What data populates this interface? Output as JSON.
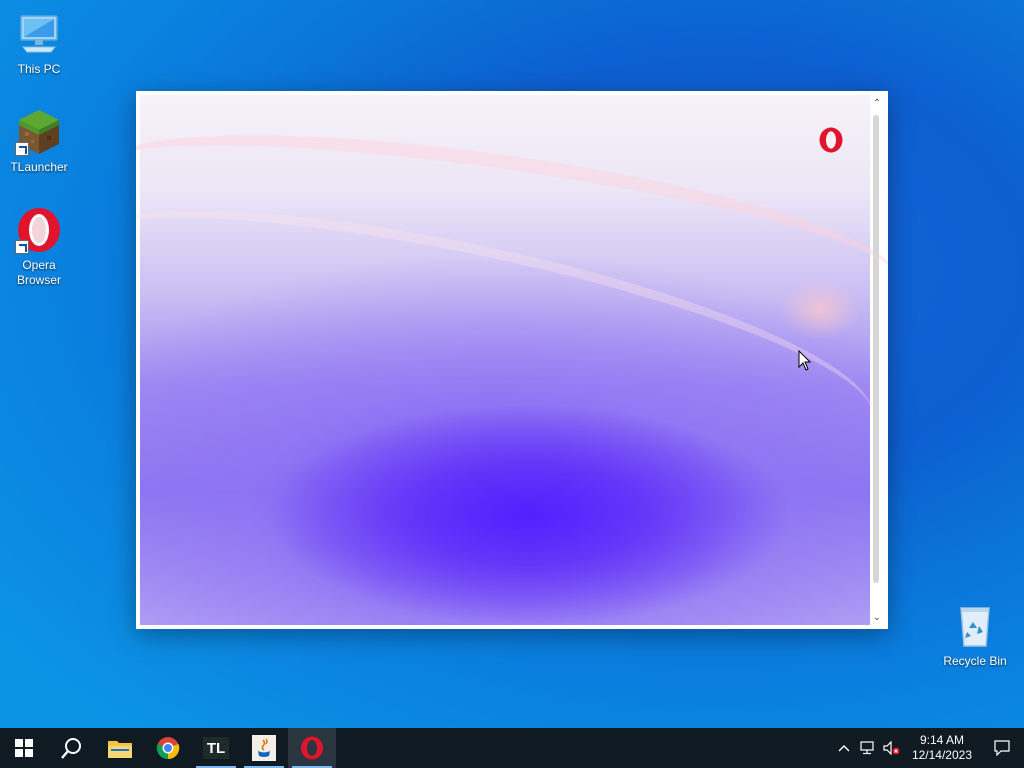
{
  "desktop": {
    "icons": [
      {
        "label": "This PC",
        "icon": "computer-icon"
      },
      {
        "label": "TLauncher",
        "icon": "tlauncher-grass-block-icon"
      },
      {
        "label": "Opera Browser",
        "icon": "opera-icon"
      },
      {
        "label": "Recycle Bin",
        "icon": "recycle-bin-icon"
      }
    ]
  },
  "installer": {
    "icon": "opera-logo-icon",
    "accent": "#e0142c"
  },
  "taskbar": {
    "apps": [
      {
        "icon": "start-windows-icon"
      },
      {
        "icon": "search-icon"
      },
      {
        "icon": "file-explorer-icon"
      },
      {
        "icon": "chrome-icon"
      },
      {
        "icon": "tlauncher-icon",
        "label": "TL"
      },
      {
        "icon": "java-icon"
      },
      {
        "icon": "opera-icon"
      }
    ],
    "time": "9:14 AM",
    "date": "12/14/2023"
  },
  "colors": {
    "taskbar": "#0f1a23",
    "desktop": "#0d5fd0"
  }
}
